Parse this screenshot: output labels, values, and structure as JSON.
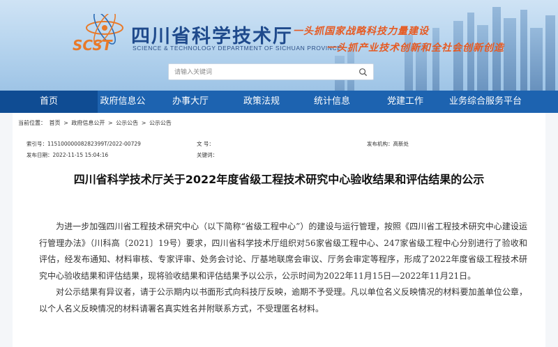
{
  "header": {
    "title": "四川省科学技术厅",
    "subtitle": "SCIENCE & TECHNOLOGY DEPARTMENT OF SICHUAN PROVINCE",
    "logo_text": "SCST",
    "slogan_line1": "一头抓国家战略科技力量建设",
    "slogan_line2": "一头抓产业技术创新和全社会创新创造"
  },
  "search": {
    "placeholder": "请输入关键词",
    "icon": "search-icon"
  },
  "nav": {
    "items": [
      {
        "label": "首页"
      },
      {
        "label": "政府信息公开"
      },
      {
        "label": "办事大厅"
      },
      {
        "label": "政策法规"
      },
      {
        "label": "统计信息"
      },
      {
        "label": "党建工作"
      },
      {
        "label": "业务综合服务平台"
      }
    ]
  },
  "breadcrumb": {
    "prefix": "当前位置：",
    "items": [
      "首页",
      "政府信息公开",
      "公示公告",
      "公示公告"
    ],
    "separator": ">"
  },
  "meta": {
    "index_label": "索引号：",
    "index_value": "11510000008282399T/2022-00729",
    "docno_label": "文 号：",
    "docno_value": "",
    "agency_label": "发布机构：",
    "agency_value": "高新处",
    "date_label": "发布日期：",
    "date_value": "2022-11-15 15:04:16",
    "keywords_label": "关键词：",
    "keywords_value": ""
  },
  "article": {
    "title": "四川省科学技术厅关于2022年度省级工程技术研究中心验收结果和评估结果的公示",
    "paragraph1": "为进一步加强四川省工程技术研究中心（以下简称“省级工程中心”）的建设与运行管理，按照《四川省工程技术研究中心建设运行管理办法》（川科高〔2021〕19号）要求，四川省科学技术厅组织对56家省级工程中心、247家省级工程中心分别进行了验收和评估，经发布通知、材料审核、专家评审、处务会讨论、厅基地联席会审议、厅务会审定等程序，形成了2022年度省级工程技术研究中心验收结果和评估结果，现将验收结果和评估结果予以公示，公示时间为2022年11月15日—2022年11月21日。",
    "paragraph2": "对公示结果有异议者，请于公示期内以书面形式向科技厅反映，逾期不予受理。凡以单位名义反映情况的材料要加盖单位公章，以个人名义反映情况的材料请署名真实姓名并附联系方式，不受理匿名材料。"
  },
  "colors": {
    "nav_bg": "#1d63b0",
    "nav_active": "#0f4c93",
    "title_blue": "#1f4a8c",
    "slogan_orange": "#e65a22"
  }
}
